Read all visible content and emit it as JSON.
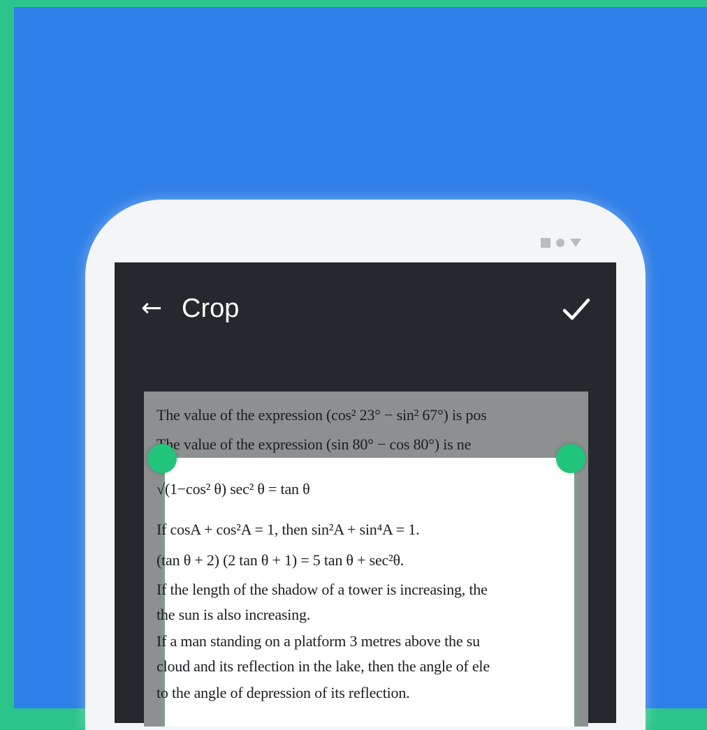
{
  "colors": {
    "frame": "#2bc48a",
    "background": "#2f7fe8",
    "screen": "#25282c",
    "handle": "#21c57b"
  },
  "statusbar": {
    "icons": [
      "square-icon",
      "dot-icon",
      "signal-icon"
    ]
  },
  "topbar": {
    "back_icon": "←",
    "title": "Crop",
    "confirm_icon": "check-icon"
  },
  "document": {
    "lines": [
      "The value of the expression (cos² 23° − sin² 67°) is pos",
      "The value of the expression (sin 80° − cos 80°) is ne",
      "√(1−cos² θ) sec² θ = tan θ",
      "If cosA + cos²A = 1, then sin²A + sin⁴A = 1.",
      "(tan θ + 2) (2 tan θ + 1) = 5 tan θ + sec²θ.",
      "If the length of the shadow of a tower is increasing, the",
      "the sun is also increasing.",
      "If a man standing on a platform 3 metres above the su",
      "cloud and its reflection in the lake, then the angle of ele",
      "to the angle of depression of its reflection."
    ]
  }
}
